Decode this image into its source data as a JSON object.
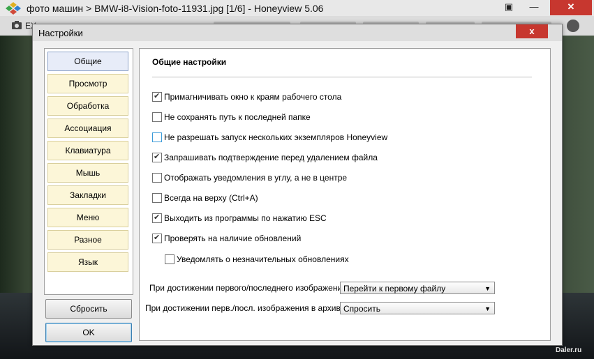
{
  "app": {
    "title": "фото машин > BMW-i8-Vision-foto-11931.jpg [1/6] - Honeyview 5.06",
    "toolbar_text": "EX",
    "watermark": "Daler.ru"
  },
  "dialog": {
    "title": "Настройки",
    "close_glyph": "x",
    "categories": [
      {
        "label": "Общие",
        "selected": true
      },
      {
        "label": "Просмотр"
      },
      {
        "label": "Обработка"
      },
      {
        "label": "Ассоциация"
      },
      {
        "label": "Клавиатура"
      },
      {
        "label": "Мышь"
      },
      {
        "label": "Закладки"
      },
      {
        "label": "Меню"
      },
      {
        "label": "Разное"
      },
      {
        "label": "Язык"
      }
    ],
    "buttons": {
      "reset": "Сбросить",
      "ok": "OK"
    },
    "panel": {
      "title": "Общие настройки",
      "options": [
        {
          "label": "Примагничивать окно к краям рабочего стола",
          "checked": true
        },
        {
          "label": "Не сохранять путь к последней папке",
          "checked": false
        },
        {
          "label": "Не разрешать запуск нескольких экземпляров Honeyview",
          "checked": false
        },
        {
          "label": "Запрашивать подтверждение перед удалением файла",
          "checked": true
        },
        {
          "label": "Отображать уведомления в углу, а не в центре",
          "checked": false
        },
        {
          "label": "Всегда на верху (Ctrl+A)",
          "checked": false
        },
        {
          "label": "Выходить из программы по нажатию ESC",
          "checked": true
        },
        {
          "label": "Проверять на наличие обновлений",
          "checked": true
        },
        {
          "label": "Уведомлять о незначительных обновлениях",
          "checked": false
        }
      ],
      "first_last_label": "При достижении первого/последнего изображения:",
      "first_last_value": "Перейти к первому файлу",
      "archive_label": "При достижении перв./посл. изображения в архиве:",
      "archive_value": "Спросить"
    }
  }
}
